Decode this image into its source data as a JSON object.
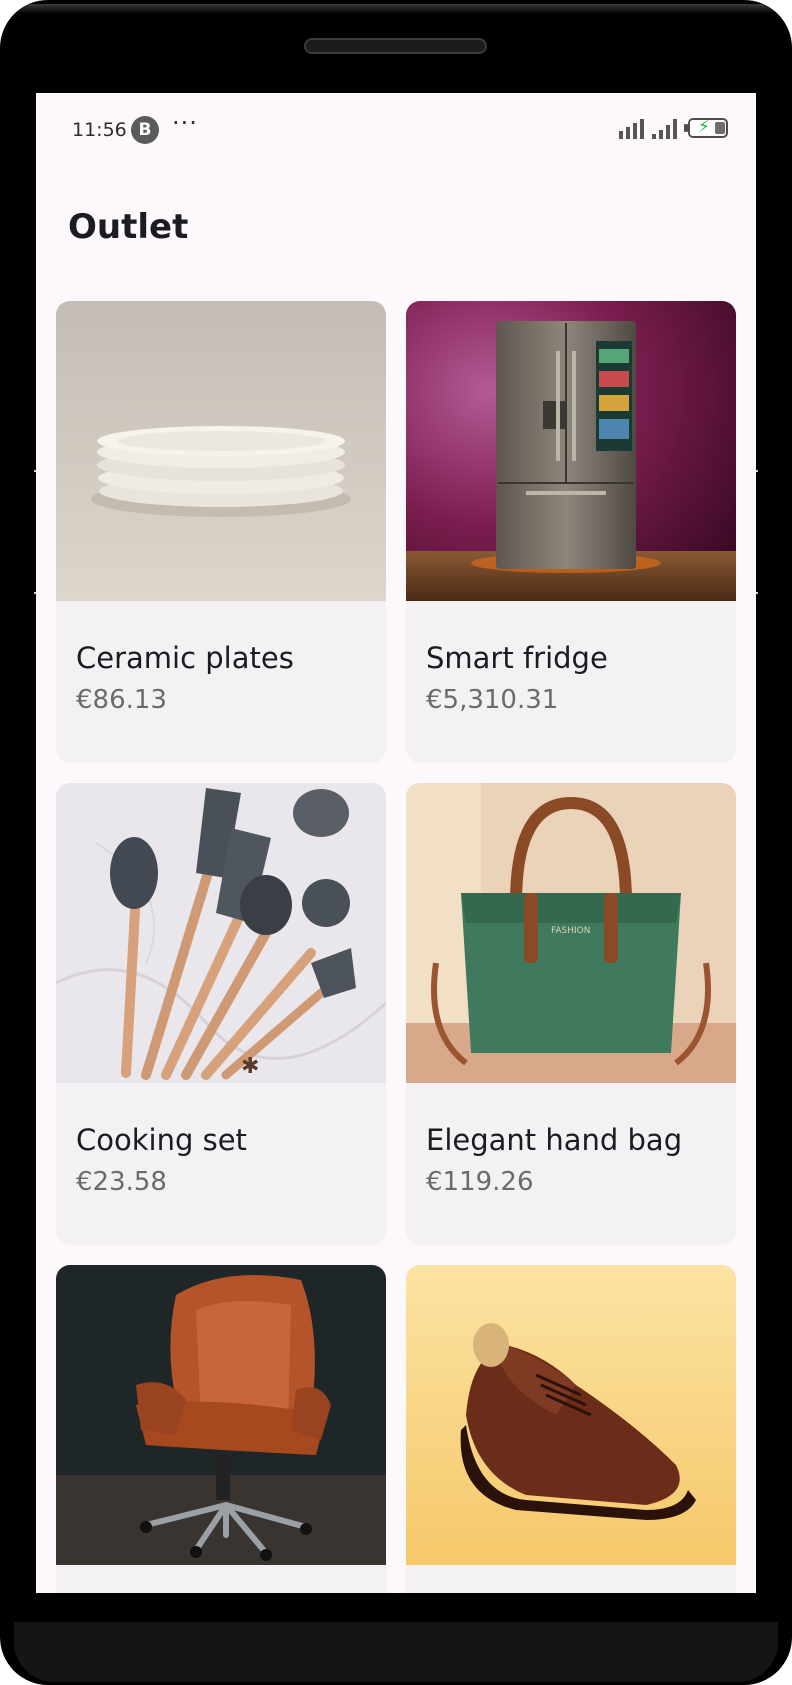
{
  "status_bar": {
    "time": "11:56",
    "app_badge": "B",
    "overflow": "···"
  },
  "page": {
    "title": "Outlet"
  },
  "products": [
    {
      "name": "Ceramic plates",
      "price": "€86.13",
      "image_icon": "plates-image"
    },
    {
      "name": "Smart fridge",
      "price": "€5,310.31",
      "image_icon": "fridge-image"
    },
    {
      "name": "Cooking set",
      "price": "€23.58",
      "image_icon": "cooking-utensils-image"
    },
    {
      "name": "Elegant hand bag",
      "price": "€119.26",
      "image_icon": "handbag-image"
    },
    {
      "name": "",
      "price": "",
      "image_icon": "office-chair-image"
    },
    {
      "name": "",
      "price": "",
      "image_icon": "leather-shoe-image"
    }
  ],
  "colors": {
    "screen_bg": "#fdf8fc",
    "card_bg": "#f3f1f3",
    "title": "#1c1b1f",
    "price": "#6b6b6b"
  }
}
